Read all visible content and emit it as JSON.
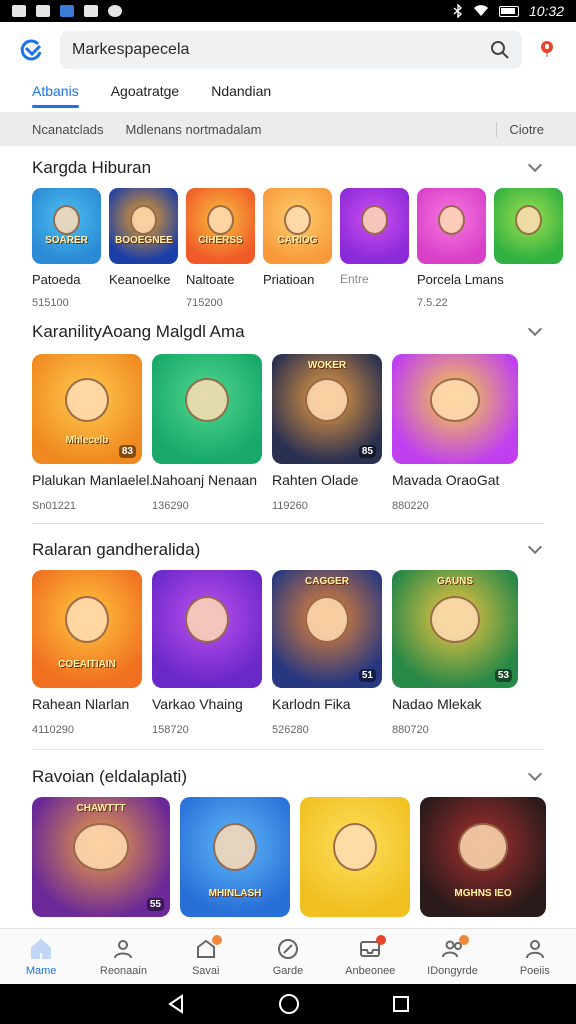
{
  "status_bar": {
    "time": "10:32"
  },
  "search": {
    "placeholder": "Markespapecela",
    "value": "Markespapecela"
  },
  "tabs": [
    {
      "label": "Atbanis",
      "active": true
    },
    {
      "label": "Agoatratge",
      "active": false
    },
    {
      "label": "Ndandian",
      "active": false
    }
  ],
  "filter_bar": {
    "left1": "Ncanatclads",
    "left2": "Mdlenans nortmadalam",
    "right": "Ciotre"
  },
  "sections": [
    {
      "title": "Kargda Hiburan",
      "items": [
        {
          "name": "Patoeda",
          "meta": "515100",
          "caption": "SOARER",
          "colors": [
            "#2a8ad6",
            "#4ec0f0"
          ]
        },
        {
          "name": "Keanoelke",
          "meta": "",
          "caption": "BOOEGNEE",
          "colors": [
            "#1a3ea8",
            "#f0a020"
          ]
        },
        {
          "name": "Naltoate",
          "meta": "715200",
          "caption": "CIHERSS",
          "colors": [
            "#f05a28",
            "#f8c040"
          ]
        },
        {
          "name": "Priatioan",
          "meta": "",
          "caption": "CARIOG",
          "colors": [
            "#f89a3a",
            "#ffd070"
          ]
        },
        {
          "name": "Entre",
          "meta": "",
          "caption": "",
          "colors": [
            "#8a2ad8",
            "#d050f0"
          ]
        },
        {
          "name": "Porcela Lmans",
          "meta": "7.5.22",
          "caption": "",
          "colors": [
            "#d840c8",
            "#f878e0"
          ]
        },
        {
          "name": "",
          "meta": "",
          "caption": "",
          "colors": [
            "#30b040",
            "#a0e050"
          ]
        }
      ]
    },
    {
      "title": "KaranilityAoang Malgdl Ama",
      "items": [
        {
          "name": "Plalukan Manlaelel..",
          "meta": "Sn01221",
          "caption": "Mhlecelb",
          "badge": "83",
          "colors": [
            "#f08a20",
            "#ffcc50"
          ]
        },
        {
          "name": "Nahoanj Nenaan",
          "meta": "136290",
          "caption": "",
          "badge": "",
          "colors": [
            "#18a868",
            "#50d890"
          ]
        },
        {
          "name": "Rahten Olade",
          "meta": "119260",
          "caption": "WOKER",
          "badge": "85",
          "colors": [
            "#2a3050",
            "#f0a040"
          ]
        },
        {
          "name": "Mavada OraoGat",
          "meta": "880220",
          "caption": "",
          "badge": "",
          "colors": [
            "#c040f0",
            "#f8d040"
          ]
        }
      ]
    },
    {
      "title": "Ralaran gandheralida)",
      "items": [
        {
          "name": "Rahean Nlarlan",
          "meta": "4110290",
          "caption": "COEAITIAIN",
          "badge": "",
          "colors": [
            "#f07020",
            "#ffc840"
          ]
        },
        {
          "name": "Varkao Vhaing",
          "meta": "158720",
          "caption": "",
          "badge": "",
          "colors": [
            "#6a28c8",
            "#c050f0"
          ]
        },
        {
          "name": "Karlodn Fika",
          "meta": "526280",
          "caption": "CAGGER",
          "badge": "51",
          "colors": [
            "#283880",
            "#f08830"
          ]
        },
        {
          "name": "Nadao Mlekak",
          "meta": "880720",
          "caption": "GAUNS",
          "badge": "53",
          "colors": [
            "#288848",
            "#f8c840"
          ]
        }
      ]
    },
    {
      "title": "Ravoian (eldalaplati)",
      "items": [
        {
          "name": "",
          "meta": "",
          "caption": "CHAWTTT",
          "badge": "55",
          "colors": [
            "#6a2898",
            "#f0a040"
          ]
        },
        {
          "name": "",
          "meta": "",
          "caption": "MHINLASH",
          "badge": "",
          "colors": [
            "#2870d8",
            "#60b8f8"
          ]
        },
        {
          "name": "",
          "meta": "",
          "caption": "",
          "badge": "",
          "colors": [
            "#f0c020",
            "#ffe060"
          ]
        },
        {
          "name": "",
          "meta": "",
          "caption": "MGHNS IEO",
          "badge": "",
          "colors": [
            "#2a1a1a",
            "#a83030"
          ]
        }
      ]
    }
  ],
  "bottom_nav": [
    {
      "label": "Mame",
      "icon": "home-icon",
      "active": true
    },
    {
      "label": "Reonaain",
      "icon": "user-icon",
      "active": false
    },
    {
      "label": "Savai",
      "icon": "notification-icon",
      "active": false
    },
    {
      "label": "Garde",
      "icon": "tools-icon",
      "active": false
    },
    {
      "label": "Anbeonee",
      "icon": "inbox-icon",
      "active": false
    },
    {
      "label": "IDongyrde",
      "icon": "people-icon",
      "active": false
    },
    {
      "label": "Poeiis",
      "icon": "profile-icon",
      "active": false
    }
  ],
  "colors": {
    "accent": "#1a73e8",
    "notification": "#f0883a",
    "mic": "#e8462a"
  }
}
